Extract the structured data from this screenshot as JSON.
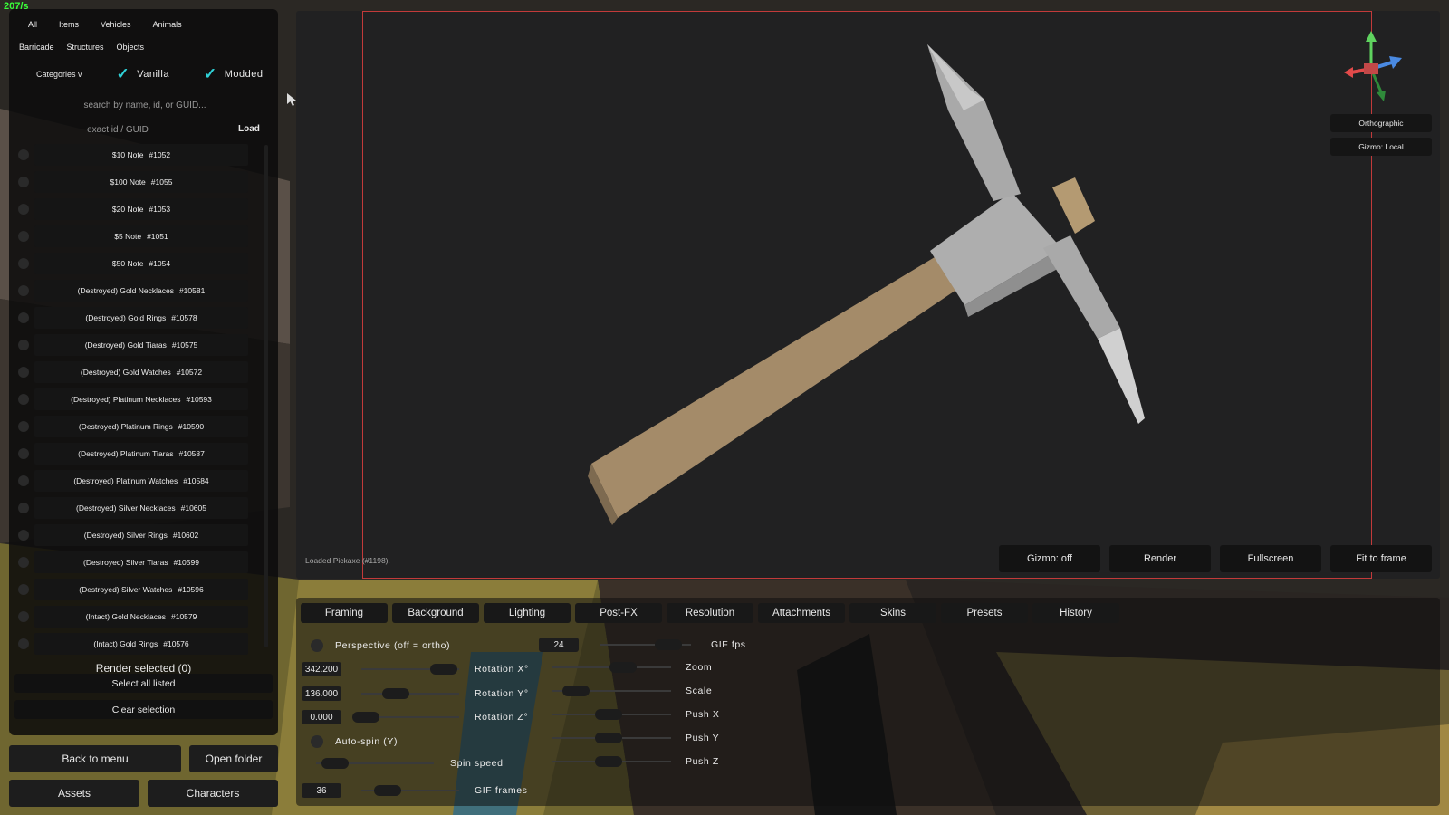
{
  "fps": "207/s",
  "sidebar": {
    "tabs_row1": [
      "All",
      "Items",
      "Vehicles",
      "Animals"
    ],
    "tabs_row2": [
      "Barricade",
      "Structures",
      "Objects"
    ],
    "categories_label": "Categories v",
    "vanilla_label": "Vanilla",
    "modded_label": "Modded",
    "search_placeholder": "search by name, id, or GUID...",
    "exact_placeholder": "exact id / GUID",
    "load_label": "Load",
    "items": [
      {
        "name": "$10 Note",
        "id": "#1052"
      },
      {
        "name": "$100 Note",
        "id": "#1055"
      },
      {
        "name": "$20 Note",
        "id": "#1053"
      },
      {
        "name": "$5 Note",
        "id": "#1051"
      },
      {
        "name": "$50 Note",
        "id": "#1054"
      },
      {
        "name": "(Destroyed) Gold Necklaces",
        "id": "#10581"
      },
      {
        "name": "(Destroyed) Gold Rings",
        "id": "#10578"
      },
      {
        "name": "(Destroyed) Gold Tiaras",
        "id": "#10575"
      },
      {
        "name": "(Destroyed) Gold Watches",
        "id": "#10572"
      },
      {
        "name": "(Destroyed) Platinum Necklaces",
        "id": "#10593"
      },
      {
        "name": "(Destroyed) Platinum Rings",
        "id": "#10590"
      },
      {
        "name": "(Destroyed) Platinum Tiaras",
        "id": "#10587"
      },
      {
        "name": "(Destroyed) Platinum Watches",
        "id": "#10584"
      },
      {
        "name": "(Destroyed) Silver Necklaces",
        "id": "#10605"
      },
      {
        "name": "(Destroyed) Silver Rings",
        "id": "#10602"
      },
      {
        "name": "(Destroyed) Silver Tiaras",
        "id": "#10599"
      },
      {
        "name": "(Destroyed) Silver Watches",
        "id": "#10596"
      },
      {
        "name": "(Intact) Gold Necklaces",
        "id": "#10579"
      },
      {
        "name": "(Intact) Gold Rings",
        "id": "#10576"
      }
    ],
    "render_selected": "Render selected (0)",
    "select_all": "Select all listed",
    "clear_selection": "Clear selection",
    "back_to_menu": "Back to menu",
    "open_folder": "Open folder",
    "assets": "Assets",
    "characters": "Characters"
  },
  "viewport": {
    "orthographic": "Orthographic",
    "gizmo_local": "Gizmo: Local",
    "status": "Loaded Pickaxe (#1198).",
    "gizmo_off": "Gizmo: off",
    "render": "Render",
    "fullscreen": "Fullscreen",
    "fit_to_frame": "Fit to frame"
  },
  "panel": {
    "tabs": [
      "Framing",
      "Background",
      "Lighting",
      "Post-FX",
      "Resolution",
      "Attachments",
      "Skins",
      "Presets",
      "History"
    ],
    "perspective_label": "Perspective (off = ortho)",
    "gif_fps_value": "24",
    "gif_fps_label": "GIF fps",
    "rotation_x_value": "342.200",
    "rotation_x_label": "Rotation X°",
    "zoom_label": "Zoom",
    "rotation_y_value": "136.000",
    "rotation_y_label": "Rotation Y°",
    "scale_label": "Scale",
    "rotation_z_value": "0.000",
    "rotation_z_label": "Rotation Z°",
    "push_x_label": "Push X",
    "auto_spin_label": "Auto-spin (Y)",
    "push_y_label": "Push Y",
    "spin_speed_label": "Spin speed",
    "push_z_label": "Push Z",
    "gif_frames_value": "36",
    "gif_frames_label": "GIF frames"
  },
  "colors": {
    "accent_check": "#2fd0d6",
    "frame_guide": "#c23a3a",
    "fps_text": "#39ff39",
    "handle_wood": "#a48b69",
    "pick_metal": "#a9a9a9"
  }
}
